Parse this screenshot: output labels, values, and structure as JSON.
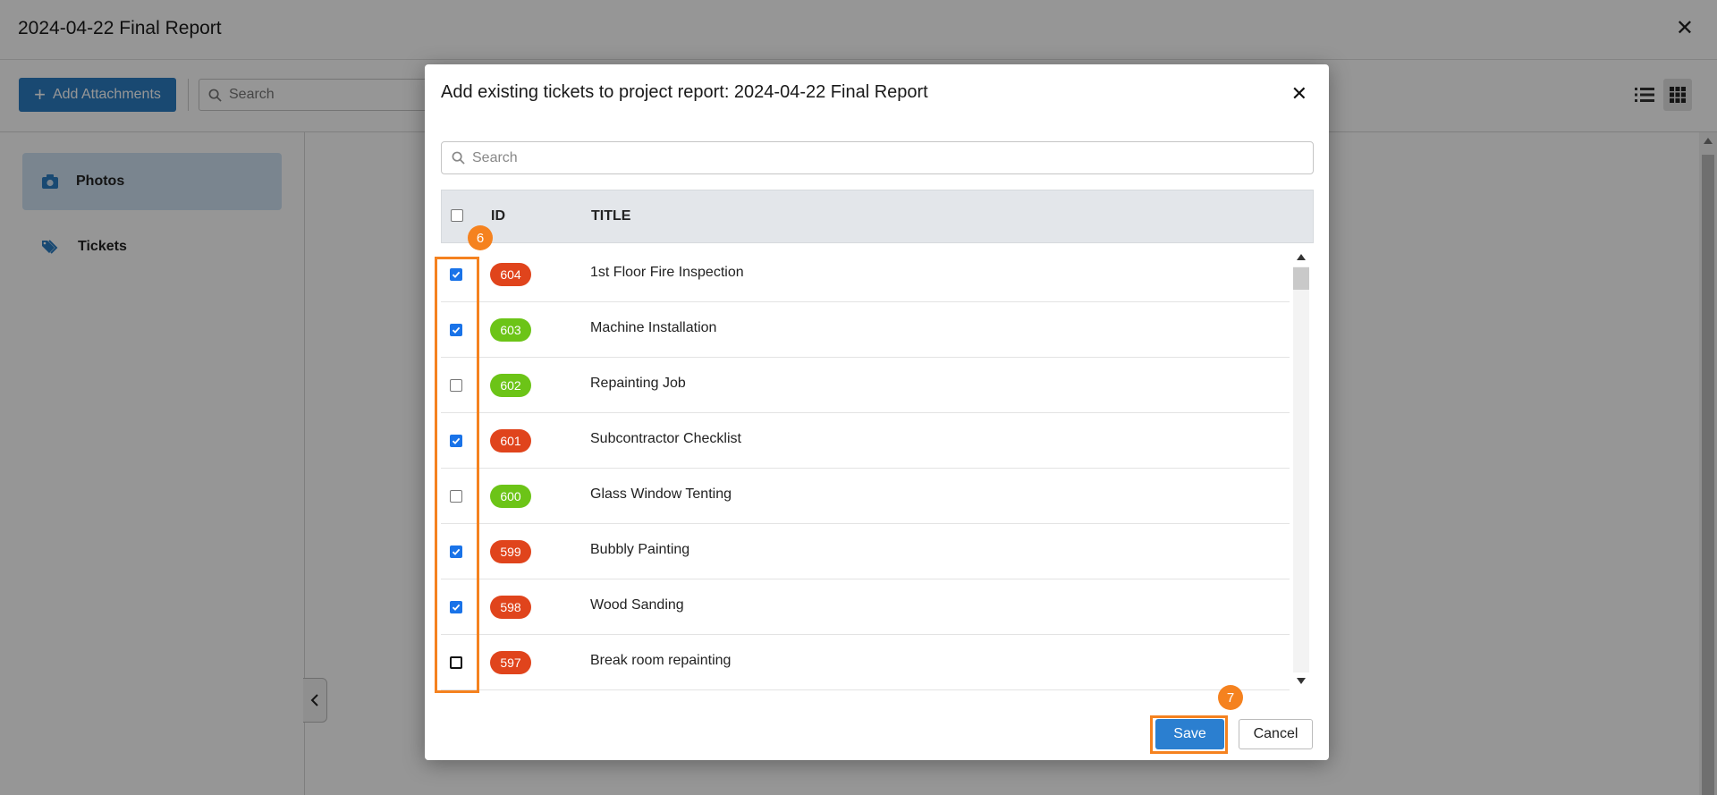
{
  "page": {
    "title": "2024-04-22 Final Report",
    "add_attachments_label": "Add Attachments",
    "search_placeholder": "Search",
    "sidebar": [
      {
        "label": "Photos",
        "icon": "camera-icon",
        "active": true
      },
      {
        "label": "Tickets",
        "icon": "tag-icon",
        "active": false
      }
    ]
  },
  "modal": {
    "title": "Add existing tickets to project report: 2024-04-22 Final Report",
    "search_placeholder": "Search",
    "columns": {
      "id": "ID",
      "title": "TITLE"
    },
    "rows": [
      {
        "id": "604",
        "title": "1st Floor Fire Inspection",
        "checked": true,
        "color": "#e0441c"
      },
      {
        "id": "603",
        "title": "Machine Installation",
        "checked": true,
        "color": "#6cc417"
      },
      {
        "id": "602",
        "title": "Repainting Job",
        "checked": false,
        "color": "#6cc417"
      },
      {
        "id": "601",
        "title": "Subcontractor Checklist",
        "checked": true,
        "color": "#e0441c"
      },
      {
        "id": "600",
        "title": "Glass Window Tenting",
        "checked": false,
        "color": "#6cc417"
      },
      {
        "id": "599",
        "title": "Bubbly Painting",
        "checked": true,
        "color": "#e0441c"
      },
      {
        "id": "598",
        "title": "Wood Sanding",
        "checked": true,
        "color": "#e0441c"
      },
      {
        "id": "597",
        "title": "Break room repainting",
        "checked": false,
        "color": "#e0441c"
      }
    ],
    "save_label": "Save",
    "cancel_label": "Cancel"
  },
  "annotations": {
    "step_checkboxes": "6",
    "step_save": "7",
    "color": "#f5821f"
  }
}
